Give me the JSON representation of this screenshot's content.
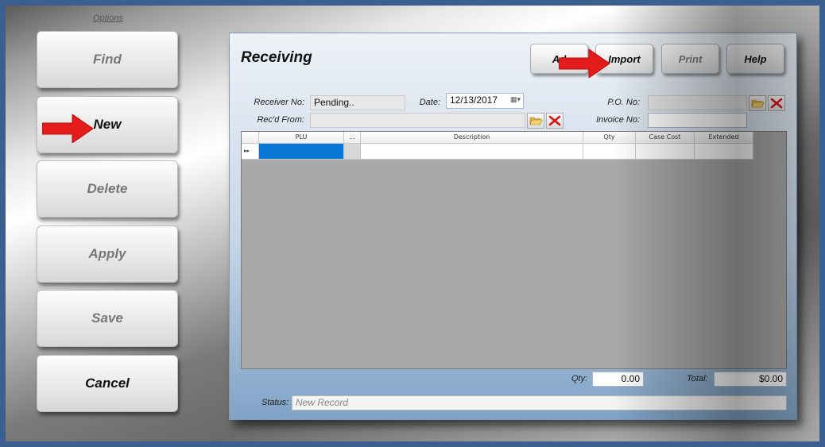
{
  "options_title": "Options",
  "sidebar": {
    "buttons": [
      {
        "label": "Find"
      },
      {
        "label": "New"
      },
      {
        "label": "Delete"
      },
      {
        "label": "Apply"
      },
      {
        "label": "Save"
      },
      {
        "label": "Cancel"
      }
    ]
  },
  "panel": {
    "title": "Receiving",
    "toolbar": {
      "add_label": "Ad",
      "import_label": "Import",
      "print_label": "Print",
      "help_label": "Help"
    },
    "form": {
      "receiver_no_label": "Receiver No:",
      "receiver_no_value": "Pending..",
      "date_label": "Date:",
      "date_value": "12/13/2017",
      "po_no_label": "P.O. No:",
      "po_no_value": "",
      "recd_from_label": "Rec'd From:",
      "recd_from_value": "",
      "invoice_no_label": "Invoice No:",
      "invoice_no_value": ""
    },
    "grid": {
      "columns": [
        "",
        "PLU",
        "...",
        "Description",
        "Qty",
        "Case Cost",
        "Extended"
      ],
      "rows": [
        [
          "▸▸",
          "",
          "",
          "",
          "",
          "",
          ""
        ]
      ]
    },
    "footer": {
      "qty_label": "Qty:",
      "qty_value": "0.00",
      "total_label": "Total:",
      "total_value": "$0.00",
      "status_label": "Status:",
      "status_value": "New Record"
    }
  },
  "colors": {
    "background_border": "#3b5f8e",
    "grid_selection": "#0a78d7",
    "arrow_red": "#e41b1b"
  }
}
